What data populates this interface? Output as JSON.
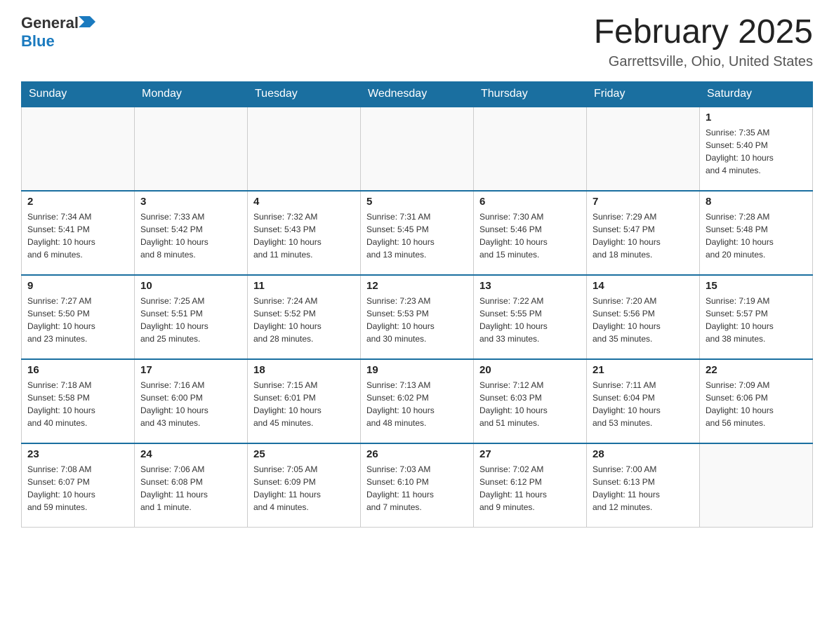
{
  "header": {
    "logo_general": "General",
    "logo_blue": "Blue",
    "month_title": "February 2025",
    "location": "Garrettsville, Ohio, United States"
  },
  "days_of_week": [
    "Sunday",
    "Monday",
    "Tuesday",
    "Wednesday",
    "Thursday",
    "Friday",
    "Saturday"
  ],
  "weeks": [
    {
      "days": [
        {
          "date": "",
          "info": ""
        },
        {
          "date": "",
          "info": ""
        },
        {
          "date": "",
          "info": ""
        },
        {
          "date": "",
          "info": ""
        },
        {
          "date": "",
          "info": ""
        },
        {
          "date": "",
          "info": ""
        },
        {
          "date": "1",
          "info": "Sunrise: 7:35 AM\nSunset: 5:40 PM\nDaylight: 10 hours\nand 4 minutes."
        }
      ]
    },
    {
      "days": [
        {
          "date": "2",
          "info": "Sunrise: 7:34 AM\nSunset: 5:41 PM\nDaylight: 10 hours\nand 6 minutes."
        },
        {
          "date": "3",
          "info": "Sunrise: 7:33 AM\nSunset: 5:42 PM\nDaylight: 10 hours\nand 8 minutes."
        },
        {
          "date": "4",
          "info": "Sunrise: 7:32 AM\nSunset: 5:43 PM\nDaylight: 10 hours\nand 11 minutes."
        },
        {
          "date": "5",
          "info": "Sunrise: 7:31 AM\nSunset: 5:45 PM\nDaylight: 10 hours\nand 13 minutes."
        },
        {
          "date": "6",
          "info": "Sunrise: 7:30 AM\nSunset: 5:46 PM\nDaylight: 10 hours\nand 15 minutes."
        },
        {
          "date": "7",
          "info": "Sunrise: 7:29 AM\nSunset: 5:47 PM\nDaylight: 10 hours\nand 18 minutes."
        },
        {
          "date": "8",
          "info": "Sunrise: 7:28 AM\nSunset: 5:48 PM\nDaylight: 10 hours\nand 20 minutes."
        }
      ]
    },
    {
      "days": [
        {
          "date": "9",
          "info": "Sunrise: 7:27 AM\nSunset: 5:50 PM\nDaylight: 10 hours\nand 23 minutes."
        },
        {
          "date": "10",
          "info": "Sunrise: 7:25 AM\nSunset: 5:51 PM\nDaylight: 10 hours\nand 25 minutes."
        },
        {
          "date": "11",
          "info": "Sunrise: 7:24 AM\nSunset: 5:52 PM\nDaylight: 10 hours\nand 28 minutes."
        },
        {
          "date": "12",
          "info": "Sunrise: 7:23 AM\nSunset: 5:53 PM\nDaylight: 10 hours\nand 30 minutes."
        },
        {
          "date": "13",
          "info": "Sunrise: 7:22 AM\nSunset: 5:55 PM\nDaylight: 10 hours\nand 33 minutes."
        },
        {
          "date": "14",
          "info": "Sunrise: 7:20 AM\nSunset: 5:56 PM\nDaylight: 10 hours\nand 35 minutes."
        },
        {
          "date": "15",
          "info": "Sunrise: 7:19 AM\nSunset: 5:57 PM\nDaylight: 10 hours\nand 38 minutes."
        }
      ]
    },
    {
      "days": [
        {
          "date": "16",
          "info": "Sunrise: 7:18 AM\nSunset: 5:58 PM\nDaylight: 10 hours\nand 40 minutes."
        },
        {
          "date": "17",
          "info": "Sunrise: 7:16 AM\nSunset: 6:00 PM\nDaylight: 10 hours\nand 43 minutes."
        },
        {
          "date": "18",
          "info": "Sunrise: 7:15 AM\nSunset: 6:01 PM\nDaylight: 10 hours\nand 45 minutes."
        },
        {
          "date": "19",
          "info": "Sunrise: 7:13 AM\nSunset: 6:02 PM\nDaylight: 10 hours\nand 48 minutes."
        },
        {
          "date": "20",
          "info": "Sunrise: 7:12 AM\nSunset: 6:03 PM\nDaylight: 10 hours\nand 51 minutes."
        },
        {
          "date": "21",
          "info": "Sunrise: 7:11 AM\nSunset: 6:04 PM\nDaylight: 10 hours\nand 53 minutes."
        },
        {
          "date": "22",
          "info": "Sunrise: 7:09 AM\nSunset: 6:06 PM\nDaylight: 10 hours\nand 56 minutes."
        }
      ]
    },
    {
      "days": [
        {
          "date": "23",
          "info": "Sunrise: 7:08 AM\nSunset: 6:07 PM\nDaylight: 10 hours\nand 59 minutes."
        },
        {
          "date": "24",
          "info": "Sunrise: 7:06 AM\nSunset: 6:08 PM\nDaylight: 11 hours\nand 1 minute."
        },
        {
          "date": "25",
          "info": "Sunrise: 7:05 AM\nSunset: 6:09 PM\nDaylight: 11 hours\nand 4 minutes."
        },
        {
          "date": "26",
          "info": "Sunrise: 7:03 AM\nSunset: 6:10 PM\nDaylight: 11 hours\nand 7 minutes."
        },
        {
          "date": "27",
          "info": "Sunrise: 7:02 AM\nSunset: 6:12 PM\nDaylight: 11 hours\nand 9 minutes."
        },
        {
          "date": "28",
          "info": "Sunrise: 7:00 AM\nSunset: 6:13 PM\nDaylight: 11 hours\nand 12 minutes."
        },
        {
          "date": "",
          "info": ""
        }
      ]
    }
  ]
}
